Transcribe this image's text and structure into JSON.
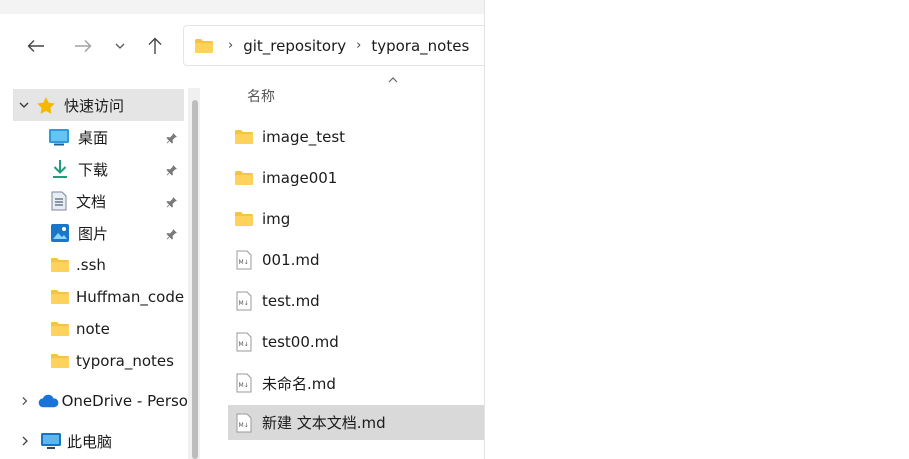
{
  "address": {
    "crumbs": [
      "git_repository",
      "typora_notes"
    ],
    "separator": "›"
  },
  "columns": {
    "name": "名称"
  },
  "sidebar": {
    "quick_access": "快速访问",
    "items": [
      {
        "label": "桌面",
        "icon": "desktop-icon",
        "pinned": true
      },
      {
        "label": "下载",
        "icon": "download-icon",
        "pinned": true
      },
      {
        "label": "文档",
        "icon": "document-icon",
        "pinned": true
      },
      {
        "label": "图片",
        "icon": "pictures-icon",
        "pinned": true
      },
      {
        "label": ".ssh",
        "icon": "folder-icon",
        "pinned": false
      },
      {
        "label": "Huffman_code",
        "icon": "folder-icon",
        "pinned": false
      },
      {
        "label": "note",
        "icon": "folder-icon",
        "pinned": false
      },
      {
        "label": "typora_notes",
        "icon": "folder-icon",
        "pinned": false
      }
    ],
    "onedrive": "OneDrive - Perso",
    "this_pc": "此电脑"
  },
  "files": [
    {
      "name": "image_test",
      "type": "folder"
    },
    {
      "name": "image001",
      "type": "folder"
    },
    {
      "name": "img",
      "type": "folder"
    },
    {
      "name": "001.md",
      "type": "markdown"
    },
    {
      "name": "test.md",
      "type": "markdown"
    },
    {
      "name": "test00.md",
      "type": "markdown"
    },
    {
      "name": "未命名.md",
      "type": "markdown"
    },
    {
      "name": "新建 文本文档.md",
      "type": "markdown",
      "selected": true
    }
  ],
  "colors": {
    "folder": "#f6c443",
    "selection": "#d9d9d9",
    "quick_access_star": "#f5b800",
    "onedrive": "#1a73d9",
    "download_arrow": "#1f9e79"
  }
}
